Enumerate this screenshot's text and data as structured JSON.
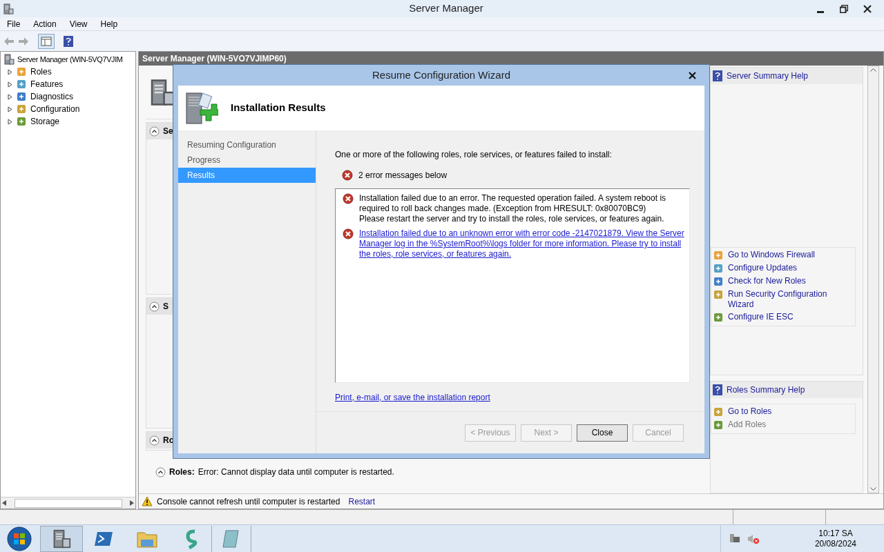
{
  "window": {
    "title": "Server Manager"
  },
  "menu": [
    "File",
    "Action",
    "View",
    "Help"
  ],
  "tree": {
    "root": "Server Manager (WIN-5VQ7VJIM",
    "children": [
      {
        "label": "Roles",
        "expanded": false
      },
      {
        "label": "Features",
        "expanded": false
      },
      {
        "label": "Diagnostics",
        "expanded": false
      },
      {
        "label": "Configuration",
        "expanded": false
      },
      {
        "label": "Storage",
        "expanded": false
      }
    ]
  },
  "pane": {
    "title": "Server Manager (WIN-5VO7VJIMP60)",
    "sections": [
      {
        "heading": "Se"
      },
      {
        "heading": "S"
      },
      {
        "heading": "Ro"
      }
    ],
    "roles_label": "Roles:",
    "roles_error": "Error: Cannot display data until computer is restarted."
  },
  "actions": [
    {
      "help": "Server Summary Help",
      "tasks": [
        {
          "label": "Go to Windows Firewall",
          "disabled": false
        },
        {
          "label": "Configure Updates",
          "disabled": false
        },
        {
          "label": "Check for New Roles",
          "disabled": false
        },
        {
          "label": "Run Security Configuration Wizard",
          "disabled": false
        },
        {
          "label": "Configure IE ESC",
          "disabled": false
        }
      ]
    },
    {
      "help": "Roles Summary Help",
      "tasks": [
        {
          "label": "Go to Roles",
          "disabled": false
        },
        {
          "label": "Add Roles",
          "disabled": true
        }
      ]
    }
  ],
  "status": {
    "message": "Console cannot refresh until computer is restarted",
    "link": "Restart"
  },
  "dialog": {
    "title": "Resume Configuration Wizard",
    "heading": "Installation Results",
    "steps": [
      {
        "label": "Resuming Configuration",
        "selected": false
      },
      {
        "label": "Progress",
        "selected": false
      },
      {
        "label": "Results",
        "selected": true
      }
    ],
    "intro": "One or more of the following roles, role services, or features failed to install:",
    "summary": "2 error messages below",
    "errors": [
      {
        "kind": "text",
        "lines": [
          "Installation failed due to an error. The requested operation failed. A system reboot is required to roll back changes made. (Exception from HRESULT: 0x80070BC9)",
          "Please restart the server and try to install the roles, role services, or features again."
        ]
      },
      {
        "kind": "link",
        "lines": [
          "Installation failed due to an unknown error with error code -2147021879. View the Server Manager log in the %SystemRoot%\\logs folder for more information. Please try to install the roles, role services, or features again."
        ]
      }
    ],
    "report_link": "Print, e-mail, or save the installation report",
    "buttons": [
      {
        "label": "< Previous",
        "disabled": true
      },
      {
        "label": "Next >",
        "disabled": true
      },
      {
        "label": "Close",
        "disabled": false
      },
      {
        "label": "Cancel",
        "disabled": true
      }
    ]
  },
  "taskbar": {
    "time": "10:17 SA",
    "date": "20/08/2024"
  }
}
